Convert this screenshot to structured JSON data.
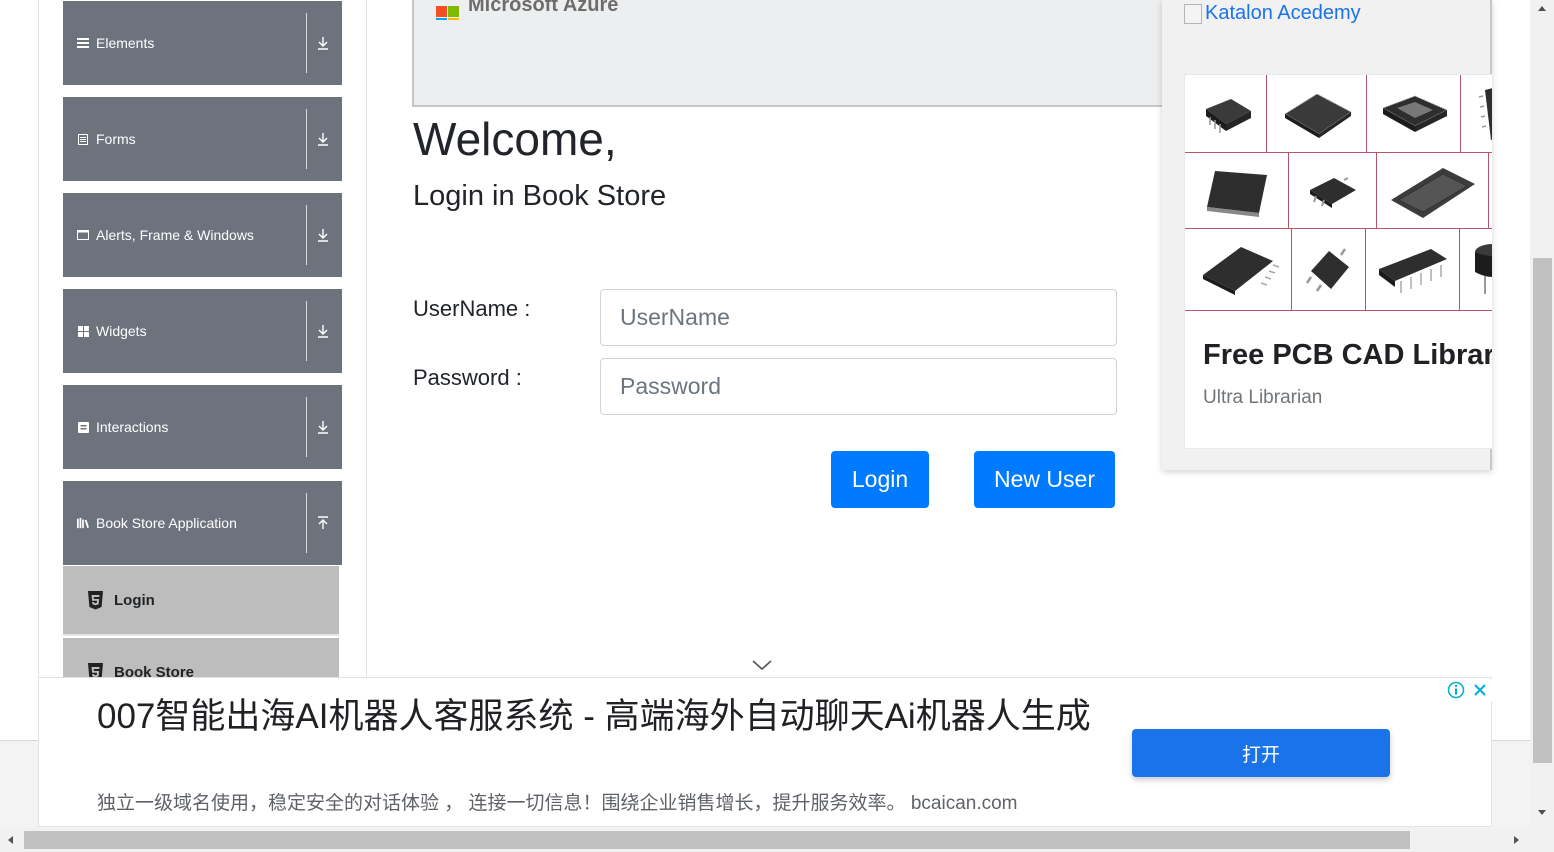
{
  "sidebar": {
    "groups": [
      {
        "label": "Elements",
        "icon": "list-icon",
        "expanded": false
      },
      {
        "label": "Forms",
        "icon": "form-icon",
        "expanded": false
      },
      {
        "label": "Alerts, Frame & Windows",
        "icon": "window-icon",
        "expanded": false
      },
      {
        "label": "Widgets",
        "icon": "grid-icon",
        "expanded": false
      },
      {
        "label": "Interactions",
        "icon": "interaction-icon",
        "expanded": false
      },
      {
        "label": "Book Store Application",
        "icon": "books-icon",
        "expanded": true
      }
    ],
    "submenu": [
      {
        "label": "Login",
        "icon": "html5-icon"
      },
      {
        "label": "Book Store",
        "icon": "html5-icon"
      }
    ]
  },
  "top_banner": {
    "text": "Microsoft Azure"
  },
  "main": {
    "welcome": "Welcome,",
    "subtitle": "Login in Book Store",
    "username_label": "UserName :",
    "username_placeholder": "UserName",
    "password_label": "Password :",
    "password_placeholder": "Password",
    "login_button": "Login",
    "new_user_button": "New User"
  },
  "right_ad": {
    "broken_image_alt": "Katalon Acedemy",
    "title": "Free PCB CAD Libraries",
    "subtitle": "Ultra Librarian",
    "divider_color": "#b7546a"
  },
  "bottom_ad": {
    "title": "007智能出海AI机器人客服系统 - 高端海外自动聊天Ai机器人生成",
    "description": "独立一级域名使用，稳定安全的对话体验 ， 连接一切信息！围绕企业销售增长，提升服务效率。 bcaican.com",
    "open_button": "打开",
    "button_color": "#1a73e8"
  },
  "colors": {
    "sidebar_header": "#6c737d",
    "submenu_bg": "#bdbdbd",
    "primary": "#007bff"
  }
}
